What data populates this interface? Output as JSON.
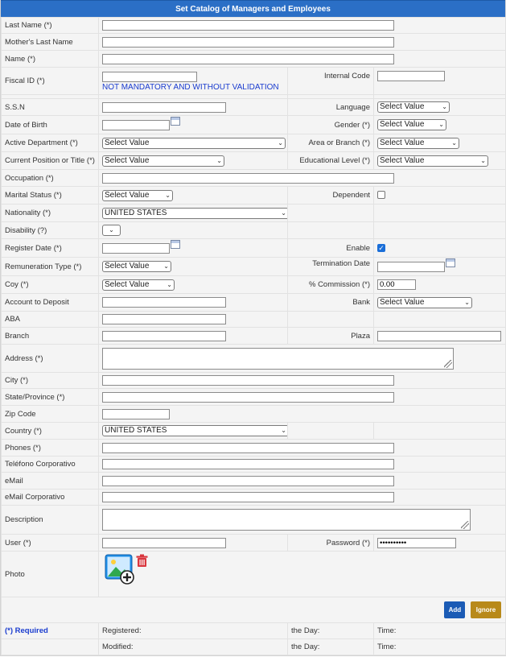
{
  "title": "Set Catalog of Managers and Employees",
  "labels": {
    "last_name": "Last Name (*)",
    "mothers_last_name": "Mother's Last Name",
    "name": "Name (*)",
    "fiscal_id": "Fiscal ID (*)",
    "fiscal_note": "NOT MANDATORY AND WITHOUT VALIDATION",
    "internal_code": "Internal Code",
    "ssn": "S.S.N",
    "language": "Language",
    "dob": "Date of Birth",
    "gender": "Gender (*)",
    "active_department": "Active Department (*)",
    "area_branch": "Area or Branch (*)",
    "current_position": "Current Position or Title (*)",
    "educational_level": "Educational Level (*)",
    "occupation": "Occupation (*)",
    "marital_status": "Marital Status (*)",
    "dependent": "Dependent",
    "nationality": "Nationality (*)",
    "disability": "Disability (?)",
    "register_date": "Register Date (*)",
    "enable": "Enable",
    "remuneration_type": "Remuneration Type (*)",
    "termination_date": "Termination Date",
    "coy": "Coy (*)",
    "commission": "% Commission (*)",
    "account": "Account to Deposit",
    "bank": "Bank",
    "aba": "ABA",
    "branch": "Branch",
    "plaza": "Plaza",
    "address": "Address (*)",
    "city": "City (*)",
    "state": "State/Province (*)",
    "zip": "Zip Code",
    "country": "Country (*)",
    "phones": "Phones (*)",
    "corp_phone": "Teléfono Corporativo",
    "email": "eMail",
    "corp_email": "eMail Corporativo",
    "description": "Description",
    "user": "User (*)",
    "password": "Password (*)",
    "photo": "Photo"
  },
  "values": {
    "select_default": "Select Value",
    "nationality": "UNITED STATES",
    "country": "UNITED STATES",
    "commission": "0.00",
    "password_mask": "••••••••••",
    "dependent_checked": false,
    "enable_checked": true
  },
  "buttons": {
    "add": "Add",
    "ignore": "Ignore"
  },
  "footer": {
    "required": "(*) Required",
    "registered": "Registered:",
    "modified": "Modified:",
    "the_day": "the Day:",
    "time": "Time:"
  },
  "colors": {
    "header": "#2b6fc6",
    "add_button": "#1b5bb5",
    "ignore_button": "#b8891a",
    "checkbox_on": "#1a6ed8"
  }
}
